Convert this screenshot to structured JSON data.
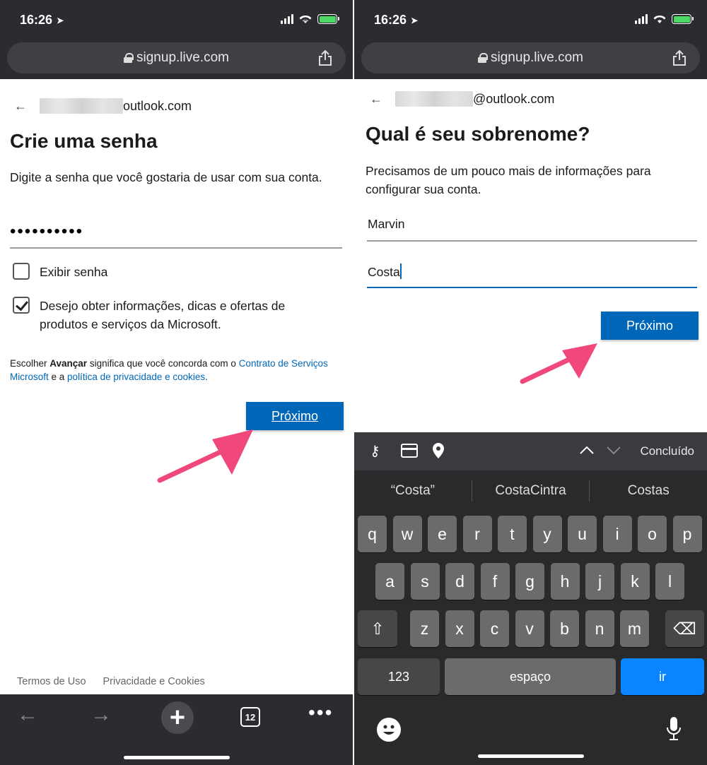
{
  "left": {
    "status": {
      "time": "16:26"
    },
    "url": "signup.live.com",
    "email_domain": "outlook.com",
    "title": "Crie uma senha",
    "description": "Digite a senha que você gostaria de usar com sua conta.",
    "password_mask": "••••••••••",
    "show_password_label": "Exibir senha",
    "marketing_label": "Desejo obter informações, dicas e ofertas de produtos e serviços da Microsoft.",
    "legal": {
      "prefix": "Escolher ",
      "bold": "Avançar",
      "middle": " significa que você concorda com o ",
      "link1": "Contrato de Serviços Microsoft",
      "and": " e a ",
      "link2": "política de privacidade e cookies",
      "suffix": "."
    },
    "next_button": "Próximo",
    "footer": {
      "terms": "Termos de Uso",
      "privacy": "Privacidade e Cookies"
    },
    "tab_count": "12"
  },
  "right": {
    "status": {
      "time": "16:26"
    },
    "url": "signup.live.com",
    "email_domain": "@outlook.com",
    "title": "Qual é seu sobrenome?",
    "description": "Precisamos de um pouco mais de informações para configurar sua conta.",
    "first_name": "Marvin",
    "last_name": "Costa",
    "next_button": "Próximo",
    "keyboard": {
      "done": "Concluído",
      "suggestions": [
        "“Costa”",
        "CostaCintra",
        "Costas"
      ],
      "row1": [
        "q",
        "w",
        "e",
        "r",
        "t",
        "y",
        "u",
        "i",
        "o",
        "p"
      ],
      "row2": [
        "a",
        "s",
        "d",
        "f",
        "g",
        "h",
        "j",
        "k",
        "l"
      ],
      "row3": [
        "z",
        "x",
        "c",
        "v",
        "b",
        "n",
        "m"
      ],
      "numbers_key": "123",
      "space_key": "espaço",
      "go_key": "ir"
    }
  },
  "colors": {
    "accent": "#0067b8",
    "arrow": "#f0487a",
    "chrome": "#2b2c30"
  }
}
